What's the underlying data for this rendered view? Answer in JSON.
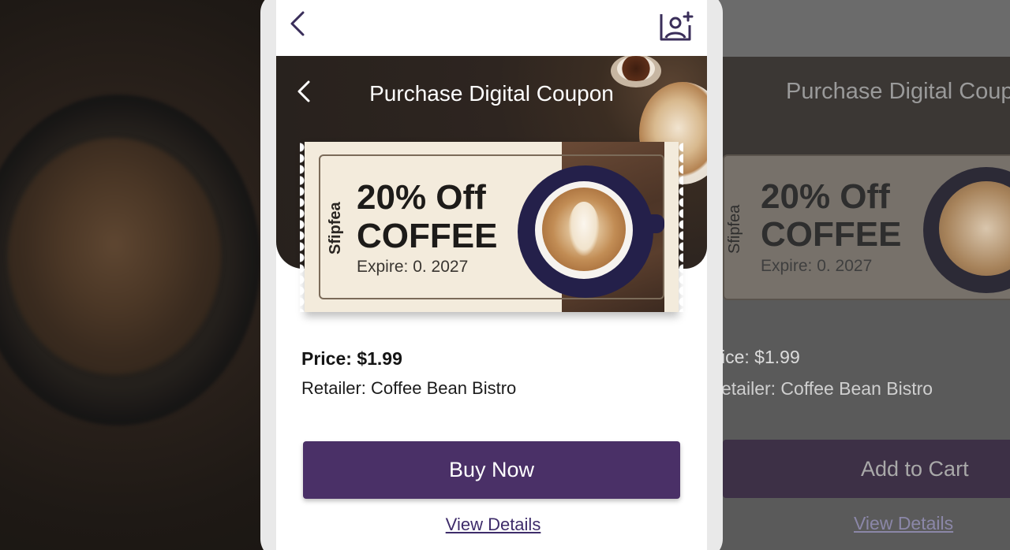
{
  "header": {
    "title": "Purchase Digital Coupon"
  },
  "coupon": {
    "brand": "Sfipfea",
    "offer_line1": "20% Off",
    "offer_line2": "COFFEE",
    "expire": "Expire: 0. 2027"
  },
  "details": {
    "price": "Price: $1.99",
    "retailer": "Retailer: Coffee Bean Bistro"
  },
  "actions": {
    "buy_label": "Buy Now",
    "view_details_label": "View Details"
  },
  "ghost": {
    "title": "Purchase Digital Coup",
    "offer_line1": "20% Off",
    "offer_line2": "COFFEE",
    "brand": "Sfipfea",
    "expire": "Expire: 0. 2027",
    "price": "ice: $1.99",
    "retailer": "etailer: Coffee Bean Bistro",
    "cart_label": "Add to Cart",
    "view_details_label": "View Details"
  },
  "icons": {
    "back": "chevron-left-icon",
    "add_photo": "add-photo-icon"
  },
  "colors": {
    "accent": "#4a3067",
    "link": "#3e2c6a"
  }
}
